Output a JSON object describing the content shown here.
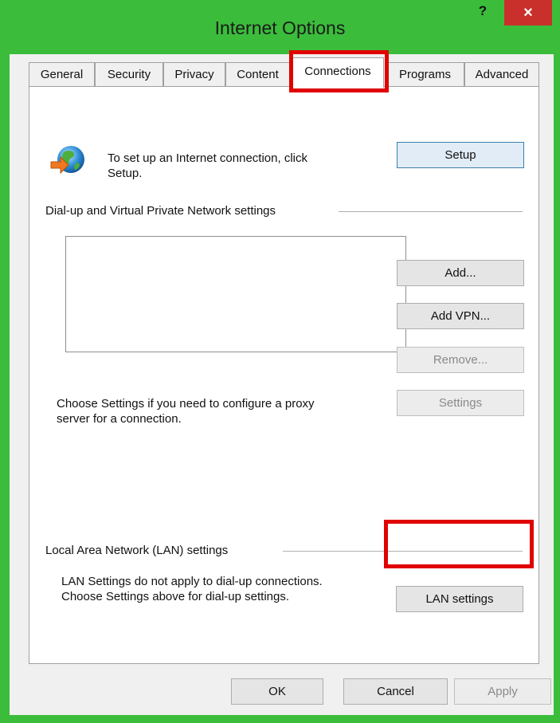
{
  "window": {
    "title": "Internet Options",
    "help_label": "?",
    "close_label": "×"
  },
  "tabs": [
    {
      "label": "General"
    },
    {
      "label": "Security"
    },
    {
      "label": "Privacy"
    },
    {
      "label": "Content"
    },
    {
      "label": "Connections",
      "active": true
    },
    {
      "label": "Programs"
    },
    {
      "label": "Advanced"
    }
  ],
  "setup": {
    "text_line1": "To set up an Internet connection, click",
    "text_line2": "Setup.",
    "button": "Setup"
  },
  "dialup": {
    "heading": "Dial-up and Virtual Private Network settings",
    "add_button": "Add...",
    "add_vpn_button": "Add VPN...",
    "remove_button": "Remove...",
    "settings_button": "Settings",
    "proxy_text_line1": "Choose Settings if you need to configure a proxy",
    "proxy_text_line2": "server for a connection."
  },
  "lan": {
    "heading": "Local Area Network (LAN) settings",
    "text_line1": "LAN Settings do not apply to dial-up connections.",
    "text_line2": "Choose Settings above for dial-up settings.",
    "button": "LAN settings"
  },
  "footer": {
    "ok": "OK",
    "cancel": "Cancel",
    "apply": "Apply"
  },
  "colors": {
    "frame": "#3bbd3b",
    "close_button": "#c9302c",
    "highlight_box": "#e00000"
  }
}
